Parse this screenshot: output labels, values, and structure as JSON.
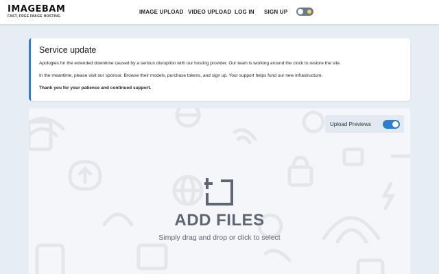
{
  "header": {
    "logo_title": "IMAGEBAM",
    "logo_tagline": "FAST, FREE IMAGE HOSTING",
    "nav": [
      {
        "label": "IMAGE UPLOAD"
      },
      {
        "label": "VIDEO UPLOAD"
      },
      {
        "label": "LOG IN"
      },
      {
        "label": "SIGN UP"
      }
    ],
    "theme_toggle_icon": "sun-moon-toggle-icon"
  },
  "notice": {
    "title": "Service update",
    "paragraphs": [
      "Apologies for the extended downtime caused by a serious disruption with our hosting provider. Our team is working around the clock to restore the site.",
      "In the meantime, please visit our sponsor. Browse their models, purchase tokens, and sign up. Your support helps fund our new infrastructure.",
      "Thank you for your patience and continued support."
    ],
    "accent_color": "#2a7fd4"
  },
  "upload": {
    "previews_label": "Upload Previews",
    "previews_enabled": true,
    "add_icon": "add-image-icon",
    "title": "ADD FILES",
    "subtitle": "Simply drag and drop or click to select"
  },
  "colors": {
    "background": "#e6edf5",
    "accent": "#2a7fd4",
    "text_muted": "#5e6672"
  }
}
